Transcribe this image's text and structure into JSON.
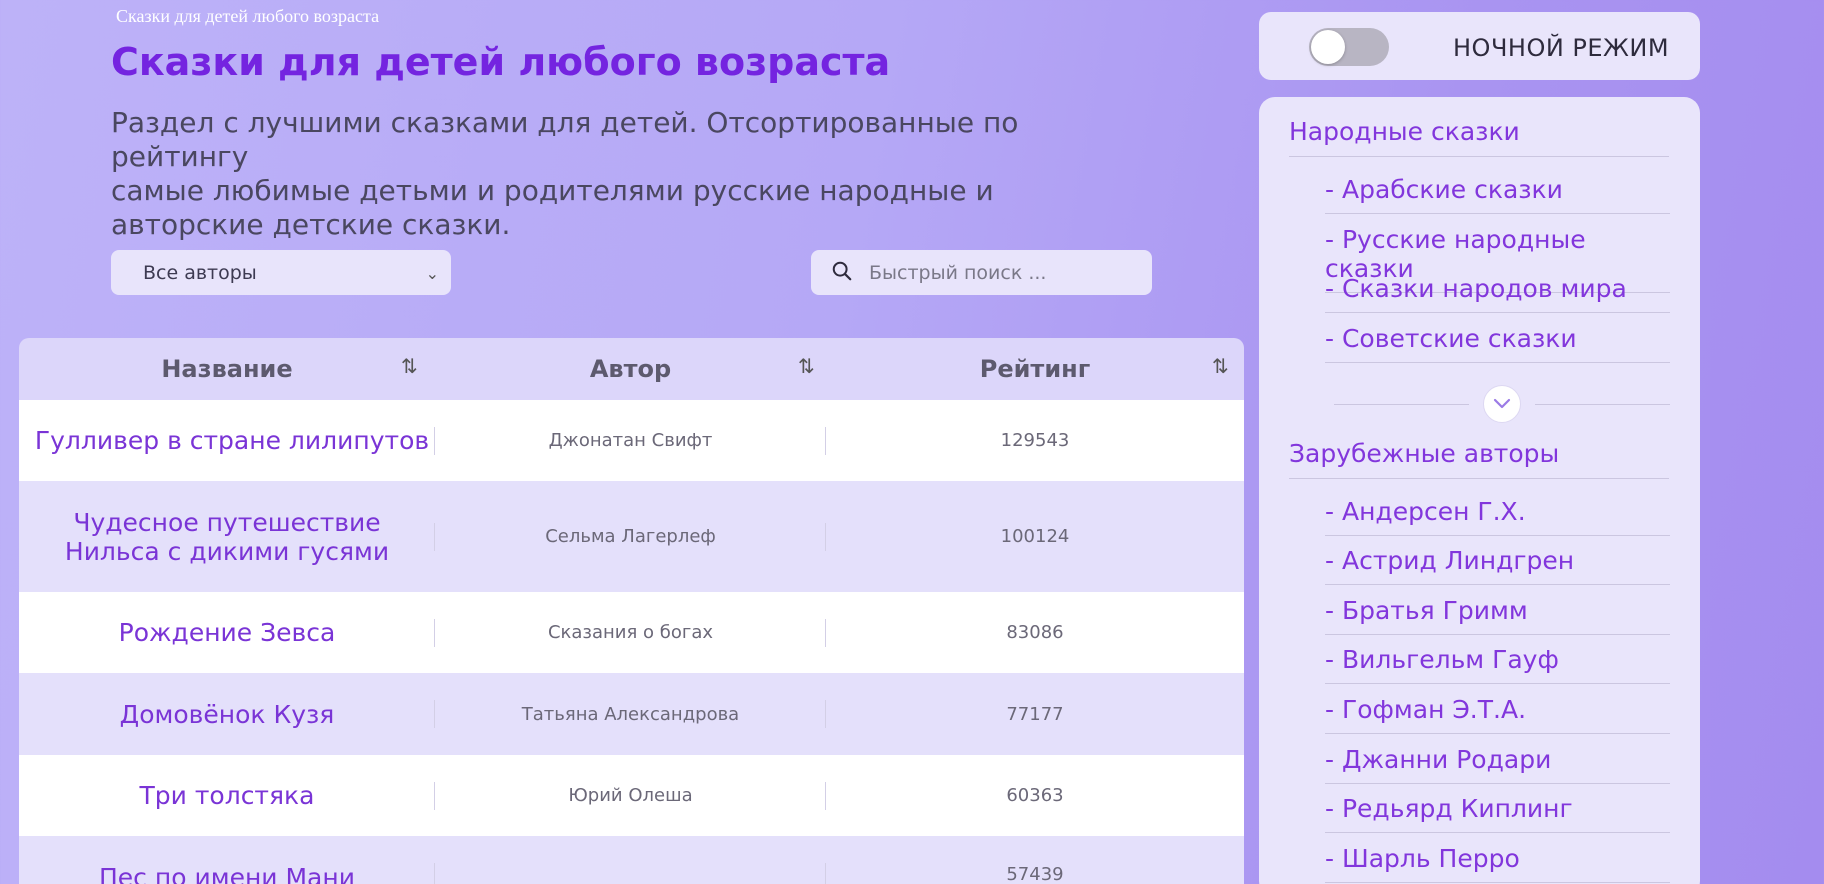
{
  "header": {
    "caption": "Сказки для детей любого возраста",
    "title": "Сказки для детей любого возраста",
    "description": "Раздел с лучшими сказками для детей. Отсортированные по рейтингу\nсамые любимые детьми и родителями русские народные и\nавторские детские сказки."
  },
  "filters": {
    "author_select": "Все авторы",
    "search_placeholder": "Быстрый поиск ...",
    "search_icon": "search-icon",
    "select_icon": "chevron-down-icon"
  },
  "table": {
    "columns": [
      "Название",
      "Автор",
      "Рейтинг"
    ],
    "sort_icon": "sort-arrows-icon",
    "rows": [
      {
        "name": "Гулливер в стране лилипутов",
        "author": "Джонатан Свифт",
        "rating": "129543"
      },
      {
        "name": "Чудесное путешествие Нильса с дикими гусями",
        "author": "Сельма Лагерлеф",
        "rating": "100124"
      },
      {
        "name": "Рождение Зевса",
        "author": "Сказания о богах",
        "rating": "83086"
      },
      {
        "name": "Домовёнок Кузя",
        "author": "Татьяна Александрова",
        "rating": "77177"
      },
      {
        "name": "Три толстяка",
        "author": "Юрий Олеша",
        "rating": "60363"
      },
      {
        "name": "Пес по имени Мани",
        "author": "",
        "rating": "57439"
      }
    ]
  },
  "night_mode": {
    "label": "НОЧНОЙ РЕЖИМ",
    "enabled": false
  },
  "sidebar": {
    "folk": {
      "title": "Народные сказки",
      "items": [
        "- Арабские сказки",
        "- Русские народные сказки",
        "- Сказки народов мира",
        "- Советские сказки"
      ]
    },
    "expand_icon": "chevron-down-icon",
    "foreign": {
      "title": "Зарубежные авторы",
      "items": [
        "- Андерсен Г.Х.",
        "- Астрид Линдгрен",
        "- Братья Гримм",
        "- Вильгельм Гауф",
        "- Гофман Э.Т.А.",
        "- Джанни Родари",
        "- Редьярд Киплинг",
        "- Шарль Перро"
      ]
    }
  },
  "colors": {
    "accent": "#7424e0",
    "link": "#7a34d6",
    "panel": "#e9e5fb",
    "row_alt": "#e4e0fb"
  }
}
